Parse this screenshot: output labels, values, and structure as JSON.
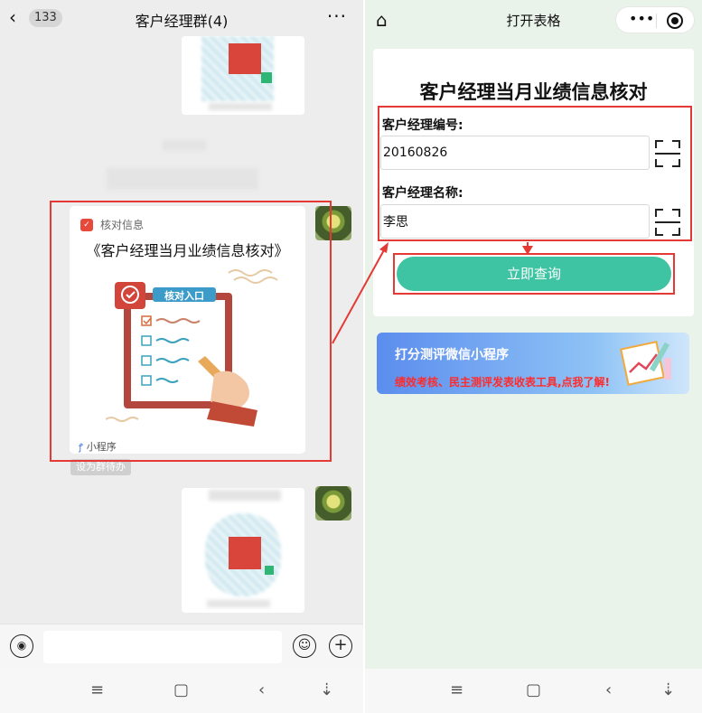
{
  "chat": {
    "back_icon": "‹",
    "unread_count": "133",
    "title": "客户经理群(4)",
    "more_icon": "···",
    "mini_program_card": {
      "source_name": "核对信息",
      "title": "《客户经理当月业绩信息核对》",
      "illustration_label": "核对入口",
      "footer": "小程序"
    },
    "set_group_label": "设为群待办"
  },
  "mini_program": {
    "header_title": "打开表格",
    "form": {
      "title": "客户经理当月业绩信息核对",
      "fields": [
        {
          "label": "客户经理编号:",
          "value": "20160826"
        },
        {
          "label": "客户经理名称:",
          "value": "李思"
        }
      ],
      "submit_label": "立即查询"
    },
    "banner": {
      "title": "打分测评微信小程序",
      "subtitle": "绩效考核、民主测评发表收表工具,点我了解!"
    }
  },
  "nav": {
    "menu_icon": "≡",
    "home_icon": "▢",
    "back_icon": "‹",
    "down_icon": "⇣"
  },
  "colors": {
    "accent_green": "#3ec3a3",
    "highlight_red": "#e53935",
    "banner_red_text": "#ff2b2b"
  }
}
